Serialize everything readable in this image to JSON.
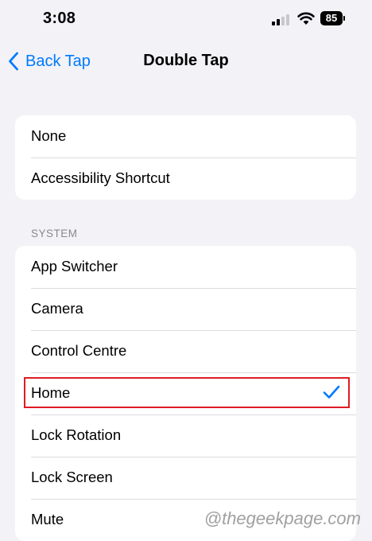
{
  "status_bar": {
    "time": "3:08",
    "battery_level": "85",
    "signal_bars_active": 2,
    "signal_bars_total": 4
  },
  "nav": {
    "back_label": "Back Tap",
    "title": "Double Tap",
    "accent_color": "#007aff"
  },
  "groups": [
    {
      "header": "",
      "items": [
        {
          "label": "None",
          "selected": false
        },
        {
          "label": "Accessibility Shortcut",
          "selected": false
        }
      ]
    },
    {
      "header": "SYSTEM",
      "items": [
        {
          "label": "App Switcher",
          "selected": false
        },
        {
          "label": "Camera",
          "selected": false
        },
        {
          "label": "Control Centre",
          "selected": false
        },
        {
          "label": "Home",
          "selected": true
        },
        {
          "label": "Lock Rotation",
          "selected": false
        },
        {
          "label": "Lock Screen",
          "selected": false
        },
        {
          "label": "Mute",
          "selected": false
        }
      ]
    }
  ],
  "highlight": {
    "color": "#e01b24",
    "target": "Home"
  },
  "watermark": "@thegeekpage.com"
}
